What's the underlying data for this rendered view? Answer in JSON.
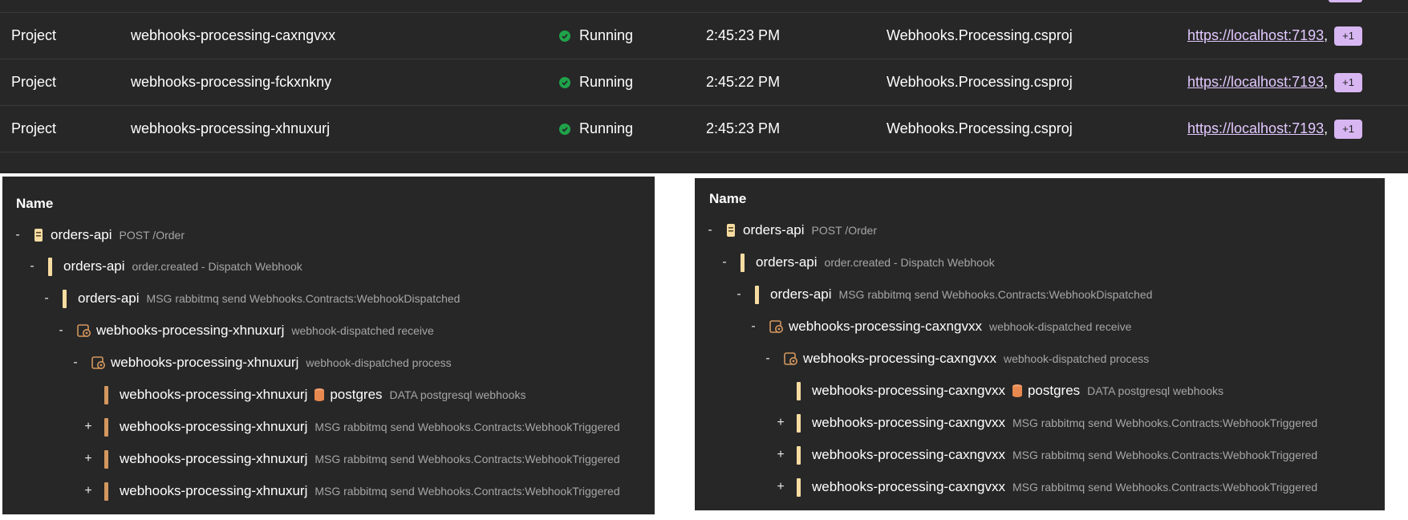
{
  "resources_table": {
    "rows": [
      {
        "type": "Project",
        "name": "webhooks-processing-caxngvxx",
        "state": "Running",
        "start_time": "2:45:23 PM",
        "source": "Webhooks.Processing.csproj",
        "endpoint": "https://localhost:7193",
        "endpoint_sep": ",",
        "more": "+1"
      },
      {
        "type": "Project",
        "name": "webhooks-processing-fckxnkny",
        "state": "Running",
        "start_time": "2:45:22 PM",
        "source": "Webhooks.Processing.csproj",
        "endpoint": "https://localhost:7193",
        "endpoint_sep": ",",
        "more": "+1"
      },
      {
        "type": "Project",
        "name": "webhooks-processing-xhnuxurj",
        "state": "Running",
        "start_time": "2:45:23 PM",
        "source": "Webhooks.Processing.csproj",
        "endpoint": "https://localhost:7193",
        "endpoint_sep": ",",
        "more": "+1"
      }
    ],
    "state_icon": "check-circle-icon",
    "colors": {
      "running": "#1fa34a",
      "link": "#e2c8ff",
      "badge": "#d7b6f2"
    }
  },
  "trace_left": {
    "header": "Name",
    "rows": [
      {
        "toggle": "-",
        "icon": "server-icon",
        "bar": "",
        "service": "orders-api",
        "desc": "POST /Order",
        "peer": ""
      },
      {
        "toggle": "-",
        "icon": "",
        "bar": "yellow",
        "service": "orders-api",
        "desc": "order.created - Dispatch Webhook",
        "peer": ""
      },
      {
        "toggle": "-",
        "icon": "",
        "bar": "yellow",
        "service": "orders-api",
        "desc": "MSG rabbitmq send Webhooks.Contracts:WebhookDispatched",
        "peer": ""
      },
      {
        "toggle": "-",
        "icon": "gear-icon",
        "bar": "",
        "service": "webhooks-processing-xhnuxurj",
        "desc": "webhook-dispatched receive",
        "peer": ""
      },
      {
        "toggle": "-",
        "icon": "gear-icon",
        "bar": "",
        "service": "webhooks-processing-xhnuxurj",
        "desc": "webhook-dispatched process",
        "peer": ""
      },
      {
        "toggle": "",
        "icon": "",
        "bar": "brown",
        "service": "webhooks-processing-xhnuxurj",
        "desc": "DATA postgresql webhooks",
        "peer": "postgres"
      },
      {
        "toggle": "+",
        "icon": "",
        "bar": "brown",
        "service": "webhooks-processing-xhnuxurj",
        "desc": "MSG rabbitmq send Webhooks.Contracts:WebhookTriggered",
        "peer": ""
      },
      {
        "toggle": "+",
        "icon": "",
        "bar": "brown",
        "service": "webhooks-processing-xhnuxurj",
        "desc": "MSG rabbitmq send Webhooks.Contracts:WebhookTriggered",
        "peer": ""
      },
      {
        "toggle": "+",
        "icon": "",
        "bar": "brown",
        "service": "webhooks-processing-xhnuxurj",
        "desc": "MSG rabbitmq send Webhooks.Contracts:WebhookTriggered",
        "peer": ""
      }
    ]
  },
  "trace_right": {
    "header": "Name",
    "rows": [
      {
        "toggle": "-",
        "icon": "server-icon",
        "bar": "",
        "service": "orders-api",
        "desc": "POST /Order",
        "peer": ""
      },
      {
        "toggle": "-",
        "icon": "",
        "bar": "yellow",
        "service": "orders-api",
        "desc": "order.created - Dispatch Webhook",
        "peer": ""
      },
      {
        "toggle": "-",
        "icon": "",
        "bar": "yellow",
        "service": "orders-api",
        "desc": "MSG rabbitmq send Webhooks.Contracts:WebhookDispatched",
        "peer": ""
      },
      {
        "toggle": "-",
        "icon": "gear-icon",
        "bar": "",
        "service": "webhooks-processing-caxngvxx",
        "desc": "webhook-dispatched receive",
        "peer": ""
      },
      {
        "toggle": "-",
        "icon": "gear-icon",
        "bar": "",
        "service": "webhooks-processing-caxngvxx",
        "desc": "webhook-dispatched process",
        "peer": ""
      },
      {
        "toggle": "",
        "icon": "",
        "bar": "yellow",
        "service": "webhooks-processing-caxngvxx",
        "desc": "DATA postgresql webhooks",
        "peer": "postgres"
      },
      {
        "toggle": "+",
        "icon": "",
        "bar": "yellow",
        "service": "webhooks-processing-caxngvxx",
        "desc": "MSG rabbitmq send Webhooks.Contracts:WebhookTriggered",
        "peer": ""
      },
      {
        "toggle": "+",
        "icon": "",
        "bar": "yellow",
        "service": "webhooks-processing-caxngvxx",
        "desc": "MSG rabbitmq send Webhooks.Contracts:WebhookTriggered",
        "peer": ""
      },
      {
        "toggle": "+",
        "icon": "",
        "bar": "yellow",
        "service": "webhooks-processing-caxngvxx",
        "desc": "MSG rabbitmq send Webhooks.Contracts:WebhookTriggered",
        "peer": ""
      }
    ],
    "peer_icon": "database-icon"
  }
}
